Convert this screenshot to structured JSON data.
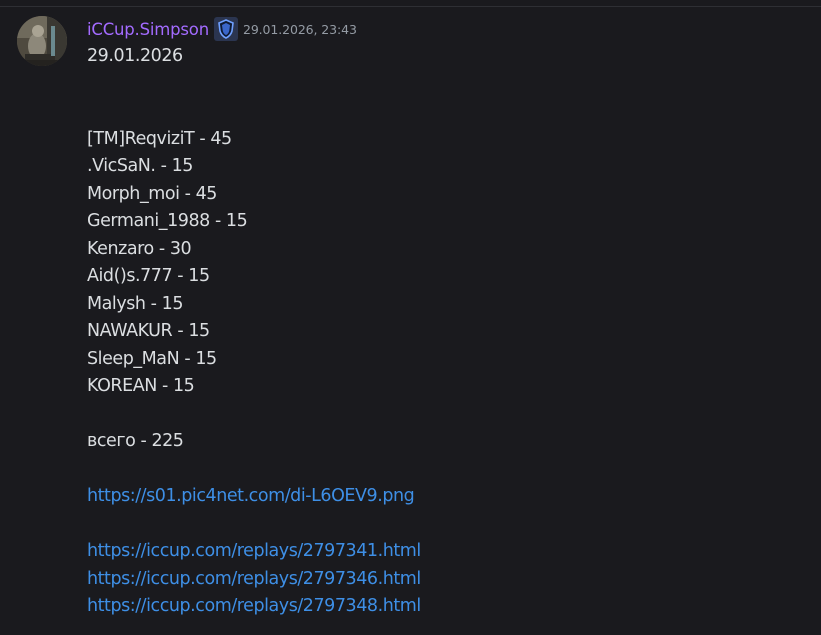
{
  "message": {
    "author": {
      "username": "iCCup.Simpson",
      "name_color": "#a36bff",
      "avatar_icon": "user-avatar-photo",
      "role_badge_icon": "shield-role-badge-icon"
    },
    "timestamp": "29.01.2026, 23:43",
    "content": {
      "date_line": "29.01.2026",
      "players": [
        "[TM]ReqviziT - 45",
        ".VicSaN. - 15",
        "Morph_moi - 45",
        "Germani_1988 - 15",
        "Kenzaro - 30",
        "Aid()s.777 - 15",
        "Malysh - 15",
        "NAWAKUR - 15",
        "Sleep_MaN - 15",
        "KOREAN - 15"
      ],
      "total_line": "всего - 225",
      "image_link": "https://s01.pic4net.com/di-L6OEV9.png",
      "replay_links": [
        "https://iccup.com/replays/2797341.html",
        "https://iccup.com/replays/2797346.html",
        "https://iccup.com/replays/2797348.html"
      ]
    }
  },
  "colors": {
    "background": "#1a1a1e",
    "text": "#dbdee1",
    "muted": "#949ba4",
    "link": "#3e8fe6"
  }
}
